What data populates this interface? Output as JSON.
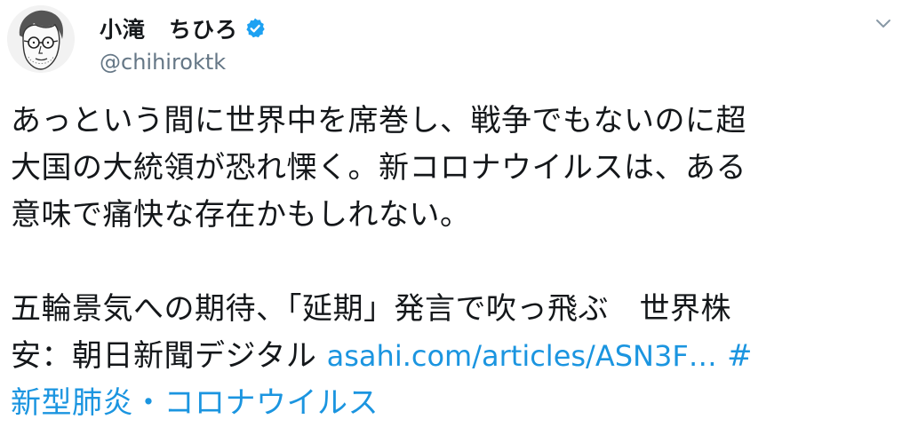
{
  "author": {
    "display_name": "小滝　ちひろ",
    "handle": "@chihiroktk",
    "verified": true
  },
  "tweet": {
    "lines": [
      "あっという間に世界中を席巻し、戦争でもないのに超",
      "大国の大統領が恐れ慄く。新コロナウイルスは、ある",
      "意味で痛快な存在かもしれない。"
    ],
    "headline_line1": "五輪景気への期待、「延期」発言で吹っ飛ぶ　世界株",
    "headline_line2_prefix": "安：朝日新聞デジタル ",
    "link_url": "asahi.com/articles/ASN3F…",
    "hashtag_mark": " #",
    "hashtag_text": "新型肺炎・コロナウイルス"
  },
  "icons": {
    "avatar": "avatar-illustration",
    "verified": "verified-badge-icon",
    "menu": "chevron-down-icon"
  },
  "colors": {
    "text": "#14171a",
    "secondary": "#657786",
    "link": "#1b95e0",
    "verified": "#1da1f2"
  }
}
